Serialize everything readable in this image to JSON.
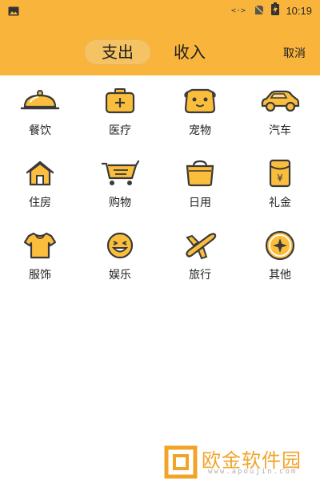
{
  "status": {
    "time": "10:19"
  },
  "header": {
    "tabs": [
      {
        "label": "支出"
      },
      {
        "label": "收入"
      }
    ],
    "cancel_label": "取消"
  },
  "categories": [
    {
      "label": "餐饮",
      "icon": "food-cover-icon"
    },
    {
      "label": "医疗",
      "icon": "medical-kit-icon"
    },
    {
      "label": "宠物",
      "icon": "pet-icon"
    },
    {
      "label": "汽车",
      "icon": "car-icon"
    },
    {
      "label": "住房",
      "icon": "house-icon"
    },
    {
      "label": "购物",
      "icon": "shopping-cart-icon"
    },
    {
      "label": "日用",
      "icon": "daily-bag-icon"
    },
    {
      "label": "礼金",
      "icon": "gift-money-icon"
    },
    {
      "label": "服饰",
      "icon": "clothing-icon"
    },
    {
      "label": "娱乐",
      "icon": "smile-face-icon"
    },
    {
      "label": "旅行",
      "icon": "airplane-icon"
    },
    {
      "label": "其他",
      "icon": "other-coin-icon"
    }
  ],
  "watermark": {
    "name": "欧金软件园",
    "url": "www.apoujin.com"
  },
  "colors": {
    "accent": "#f9b43c",
    "icon_fill": "#fbbd3c",
    "icon_stroke": "#3a3a3a"
  }
}
